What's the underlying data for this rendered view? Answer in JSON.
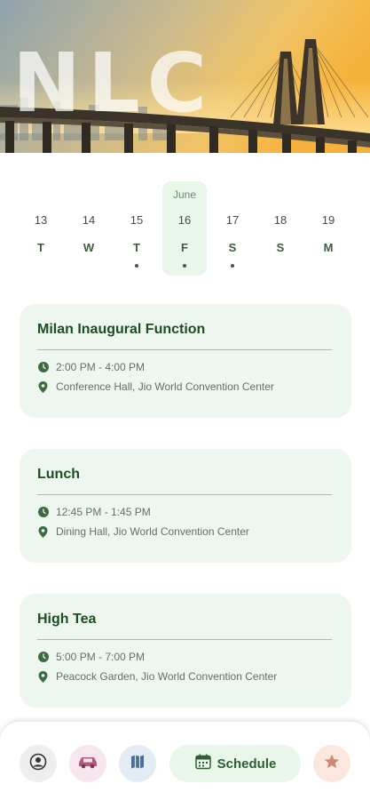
{
  "hero": {
    "title": "NLC"
  },
  "calendar": {
    "month": "June",
    "days": [
      {
        "num": "13",
        "letter": "T",
        "has_event": false
      },
      {
        "num": "14",
        "letter": "W",
        "has_event": false
      },
      {
        "num": "15",
        "letter": "T",
        "has_event": true
      },
      {
        "num": "16",
        "letter": "F",
        "has_event": true
      },
      {
        "num": "17",
        "letter": "S",
        "has_event": true
      },
      {
        "num": "18",
        "letter": "S",
        "has_event": false
      },
      {
        "num": "19",
        "letter": "M",
        "has_event": false
      }
    ],
    "selected_index": 3
  },
  "events": [
    {
      "title": "Milan Inaugural Function",
      "time": "2:00 PM - 4:00 PM",
      "location": "Conference Hall, Jio World Convention Center"
    },
    {
      "title": "Lunch",
      "time": "12:45 PM - 1:45 PM",
      "location": "Dining Hall, Jio World Convention Center"
    },
    {
      "title": "High Tea",
      "time": "5:00 PM - 7:00 PM",
      "location": "Peacock Garden, Jio World Convention Center"
    }
  ],
  "bottom_nav": {
    "items": [
      {
        "icon": "profile-icon",
        "bg": "#eeeeee"
      },
      {
        "icon": "car-icon",
        "bg": "#f7e6ee"
      },
      {
        "icon": "map-icon",
        "bg": "#e3ecf5"
      },
      {
        "icon": "star-icon",
        "bg": "#fbe7dd"
      }
    ],
    "schedule_label": "Schedule"
  },
  "colors": {
    "accent_dark": "#1d4d22",
    "card_bg": "#eef7ef",
    "selected_bg": "#e9f6ea"
  }
}
